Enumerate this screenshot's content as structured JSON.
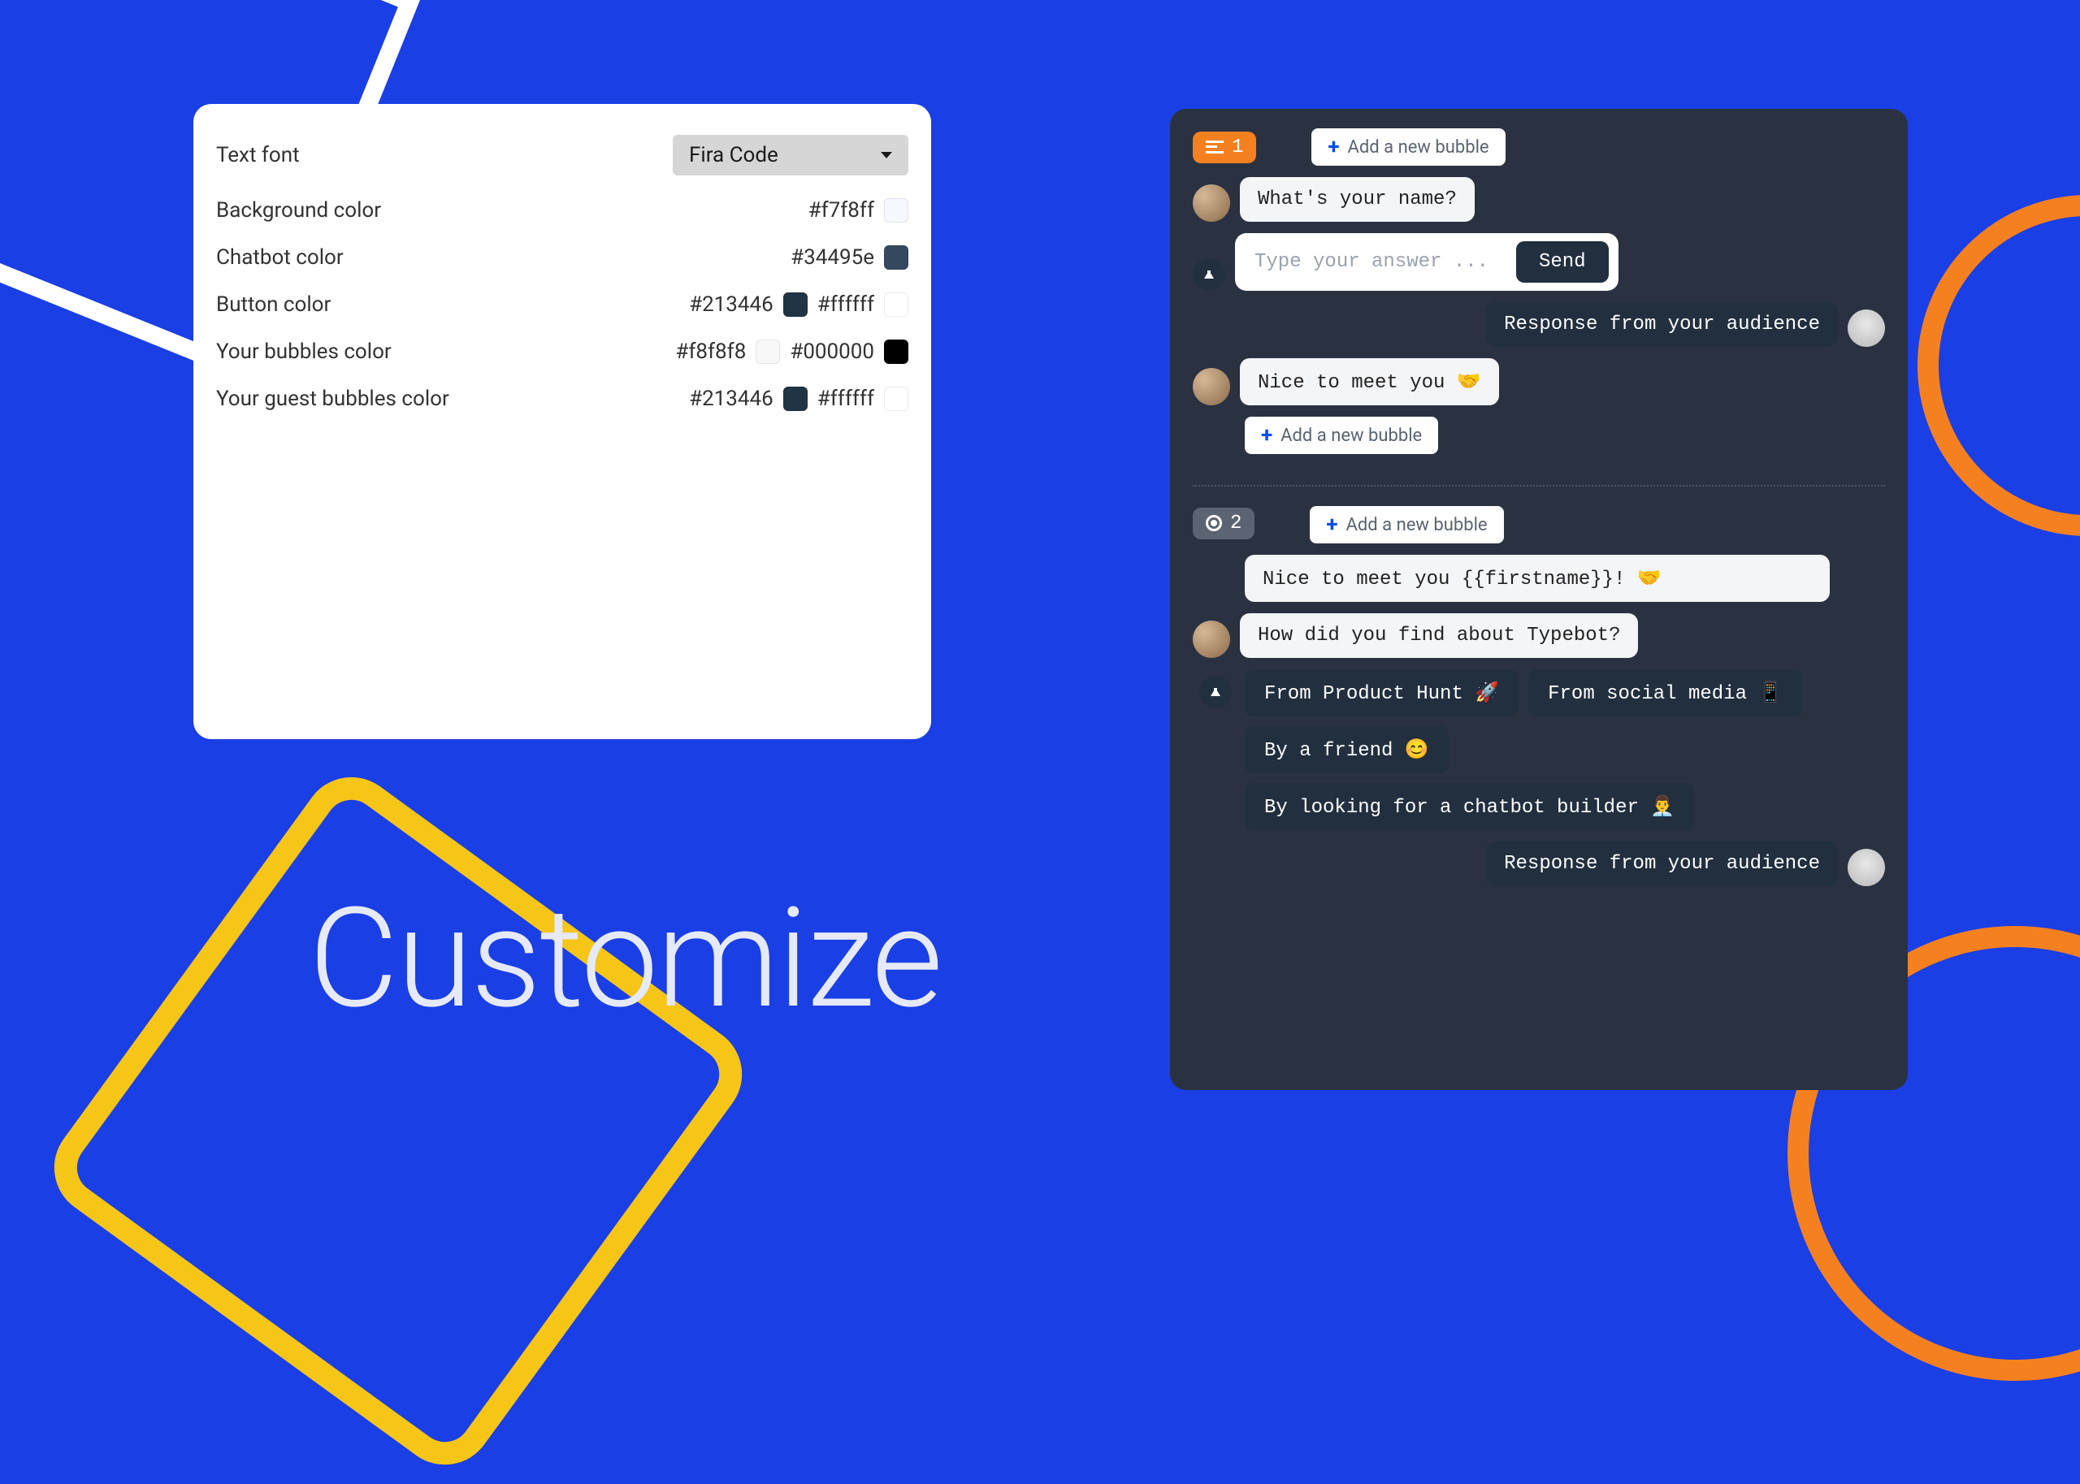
{
  "heading": "Customize",
  "panel": {
    "font_label": "Text font",
    "font_value": "Fira Code",
    "rows": [
      {
        "label": "Background color",
        "hex1": "#f7f8ff",
        "sw1": "#f7f8ff"
      },
      {
        "label": "Chatbot color",
        "hex1": "#34495e",
        "sw1": "#34495e"
      },
      {
        "label": "Button color",
        "hex1": "#213446",
        "sw1": "#213446",
        "hex2": "#ffffff",
        "sw2": "#ffffff"
      },
      {
        "label": "Your bubbles color",
        "hex1": "#f8f8f8",
        "sw1": "#f8f8f8",
        "hex2": "#000000",
        "sw2": "#000000"
      },
      {
        "label": "Your guest bubbles color",
        "hex1": "#213446",
        "sw1": "#213446",
        "hex2": "#ffffff",
        "sw2": "#ffffff"
      }
    ]
  },
  "chat": {
    "add_bubble_label": "Add a new bubble",
    "block1": {
      "num": "1",
      "msg1": "What's your name?",
      "input_placeholder": "Type your answer ...",
      "send_label": "Send",
      "response_label": "Response from your audience",
      "msg2": "Nice to meet you 🤝"
    },
    "block2": {
      "num": "2",
      "msg1": "Nice to meet you {{firstname}}! 🤝",
      "msg2": "How did you find about Typebot?",
      "options": [
        "From Product Hunt 🚀",
        "From social media 📱",
        "By a friend 😊",
        "By looking for a chatbot builder 👨‍💼"
      ],
      "response_label": "Response from your audience"
    }
  }
}
